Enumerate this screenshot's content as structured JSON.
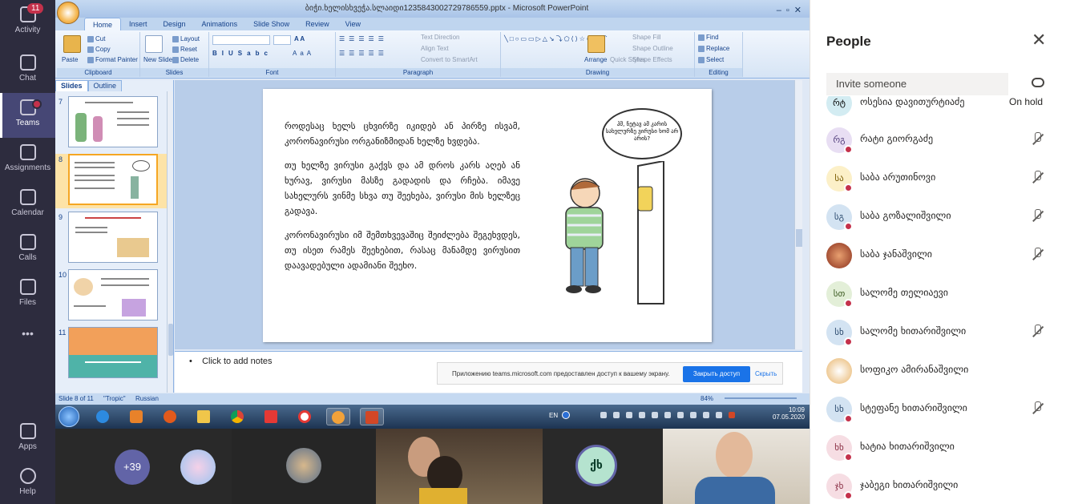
{
  "rail": {
    "items": [
      {
        "label": "Activity",
        "badge": "11"
      },
      {
        "label": "Chat"
      },
      {
        "label": "Teams"
      },
      {
        "label": "Assignments"
      },
      {
        "label": "Calendar"
      },
      {
        "label": "Calls"
      },
      {
        "label": "Files"
      },
      {
        "label": "•••"
      },
      {
        "label": "Apps"
      },
      {
        "label": "Help"
      }
    ]
  },
  "powerpoint": {
    "title": "ბიჭი.ხელისხვეჭა.სლაიდი1235843002729786559.pptx - Microsoft PowerPoint",
    "tabs": [
      "Home",
      "Insert",
      "Design",
      "Animations",
      "Slide Show",
      "Review",
      "View"
    ],
    "active_tab": "Home",
    "ribbon": {
      "clipboard": {
        "label": "Clipboard",
        "paste": "Paste",
        "cut": "Cut",
        "copy": "Copy",
        "format_painter": "Format Painter"
      },
      "slides": {
        "label": "Slides",
        "new_slide": "New Slide",
        "layout": "Layout",
        "reset": "Reset",
        "delete": "Delete"
      },
      "font": {
        "label": "Font"
      },
      "paragraph": {
        "label": "Paragraph",
        "text_direction": "Text Direction",
        "align_text": "Align Text",
        "convert": "Convert to SmartArt"
      },
      "drawing": {
        "label": "Drawing",
        "arrange": "Arrange",
        "quick_styles": "Quick Styles",
        "shape_fill": "Shape Fill",
        "shape_outline": "Shape Outline",
        "shape_effects": "Shape Effects"
      },
      "editing": {
        "label": "Editing",
        "find": "Find",
        "replace": "Replace",
        "select": "Select"
      }
    },
    "pane_tabs": [
      "Slides",
      "Outline"
    ],
    "thumbnails": [
      "7",
      "8",
      "9",
      "10",
      "11"
    ],
    "selected_thumbnail": "8",
    "slide": {
      "paragraphs": [
        "როდესაც ხელს ცხვირზე იკიდებ ან პირზე ისვამ, კორონავირუსი ორგანიზმიდან ხელზე ხვდება.",
        "თუ ხელზე ვირუსი გაქვს და ამ დროს კარს აღებ ან ხურავ, ვირუსი მასზე გადადის და რჩება. იმავე სახელურს ვინმე სხვა თუ შეეხება, ვირუსი მის ხელზეც გადავა.",
        "კორონავირუსი იმ შემთხვევაშიც შეიძლება შეგეხვდეს, თუ ისეთ რამეს შეეხებით, რასაც მანამდე ვირუსით დაავადებული ადამიანი შეეხო."
      ],
      "bubble": "ჰმ, ნეტავ ამ კარის სახელურზე ვირუსი ხომ არ არის?"
    },
    "notes_placeholder": "Click to add notes",
    "share_bar": {
      "message": "Приложению teams.microsoft.com предоставлен доступ к вашему экрану.",
      "stop_button": "Закрыть доступ",
      "hide_link": "Скрыть"
    },
    "status": {
      "slide_info": "Slide 8 of 11",
      "theme": "\"Tropic\"",
      "language": "Russian",
      "zoom": "84%"
    }
  },
  "taskbar": {
    "language": "EN",
    "time": "10:09",
    "date": "07.05.2020"
  },
  "video_strip": {
    "overflow_count": "+39",
    "presenter_initials": "ქხ"
  },
  "people_panel": {
    "title": "People",
    "invite_placeholder": "Invite someone",
    "participants": [
      {
        "initials": "რტ",
        "name": "ოსესია დავითურტიაძე",
        "extra": "On hold",
        "mic_off": false,
        "color": "#d3ecf2"
      },
      {
        "initials": "რგ",
        "name": "რატი გიორგაძე",
        "mic_off": true,
        "color": "#e8def3"
      },
      {
        "initials": "სა",
        "name": "საბა არუთინოვი",
        "mic_off": true,
        "color": "#fcf0c8"
      },
      {
        "initials": "სგ",
        "name": "საბა გოზალიშვილი",
        "mic_off": true,
        "color": "#d3e3f2"
      },
      {
        "initials": "",
        "name": "საბა ჯანაშვილი",
        "mic_off": true,
        "color": "#8a2f1c"
      },
      {
        "initials": "სთ",
        "name": "სალომე თელიაევი",
        "mic_off": false,
        "color": "#e3efd8"
      },
      {
        "initials": "სხ",
        "name": "სალომე ხითარიშვილი",
        "mic_off": true,
        "color": "#d3e3f2"
      },
      {
        "initials": "",
        "name": "სოფიკო ამირანაშვილი",
        "mic_off": false,
        "color": "#f3e9d8"
      },
      {
        "initials": "სხ",
        "name": "სტეფანე ხითარიშვილი",
        "mic_off": true,
        "color": "#d3e3f2"
      },
      {
        "initials": "ხხ",
        "name": "ხატია ხითარიშვილი",
        "mic_off": false,
        "color": "#f6dde3"
      },
      {
        "initials": "ჯხ",
        "name": "ჯაბეგი ხითარიშვილი",
        "mic_off": false,
        "color": "#f6dde3"
      }
    ]
  }
}
